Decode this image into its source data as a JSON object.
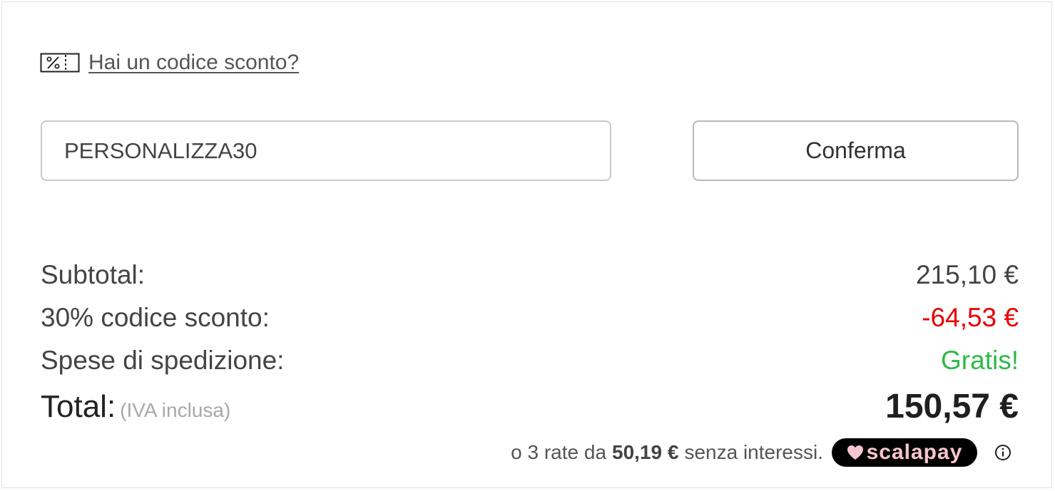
{
  "coupon": {
    "link_label": "Hai un codice sconto?",
    "icon": "percent-ticket-icon",
    "code_value": "PERSONALIZZA30",
    "confirm_label": "Conferma"
  },
  "summary": {
    "subtotal_label": "Subtotal:",
    "subtotal_value": "215,10 €",
    "discount_label": "30% codice sconto:",
    "discount_value": "-64,53 €",
    "shipping_label": "Spese di spedizione:",
    "shipping_value": "Gratis!",
    "total_label": "Total:",
    "total_note": "(IVA inclusa)",
    "total_value": "150,57 €"
  },
  "installments": {
    "prefix": "o 3 rate da",
    "amount": "50,19 €",
    "suffix": "senza interessi.",
    "brand": "scalapay",
    "brand_icon": "heart-icon",
    "info_icon": "info-icon"
  },
  "colors": {
    "discount": "#e60000",
    "free_shipping": "#2fb949",
    "scalapay_bg": "#000000",
    "scalapay_text": "#f7c5cf"
  }
}
